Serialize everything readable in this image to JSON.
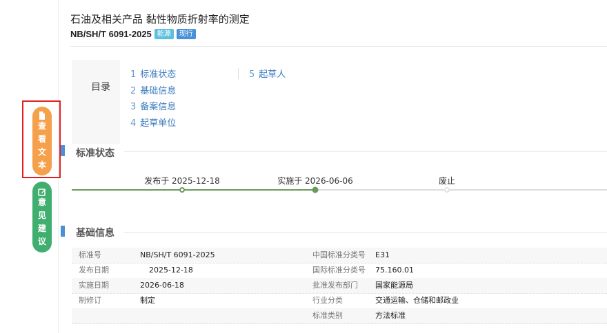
{
  "header": {
    "title": "石油及相关产品 黏性物质折射率的测定",
    "code": "NB/SH/T 6091-2025",
    "badges": [
      "能源",
      "现行"
    ]
  },
  "toc": {
    "label": "目录",
    "items": [
      {
        "num": "1",
        "label": "标准状态"
      },
      {
        "num": "2",
        "label": "基础信息"
      },
      {
        "num": "3",
        "label": "备案信息"
      },
      {
        "num": "4",
        "label": "起草单位"
      },
      {
        "num": "5",
        "label": "起草人"
      }
    ]
  },
  "status_section": {
    "title": "标准状态",
    "milestones": [
      "发布于 2025-12-18",
      "实施于 2026-06-06",
      "废止"
    ]
  },
  "basic_section": {
    "title": "基础信息",
    "left": [
      {
        "k": "标准号",
        "v": "NB/SH/T 6091-2025"
      },
      {
        "k": "发布日期",
        "v": "2025-12-18"
      },
      {
        "k": "实施日期",
        "v": "2026-06-18"
      },
      {
        "k": "制修订",
        "v": "制定"
      }
    ],
    "right": [
      {
        "k": "中国标准分类号",
        "v": "E31"
      },
      {
        "k": "国际标准分类号",
        "v": "75.160.01"
      },
      {
        "k": "批准发布部门",
        "v": "国家能源局"
      },
      {
        "k": "行业分类",
        "v": "交通运输、仓储和邮政业"
      },
      {
        "k": "标准类别",
        "v": "方法标准"
      }
    ]
  },
  "float_buttons": {
    "view_text": [
      "查",
      "看",
      "文",
      "本"
    ],
    "feedback": [
      "意",
      "见",
      "建",
      "议"
    ]
  },
  "colors": {
    "accent_blue": "#4a90d9",
    "link_blue": "#3a7bbf",
    "timeline_green": "#6a9a5a",
    "orange": "#f5a04a",
    "green": "#3fae6e",
    "highlight_red": "#e02020"
  },
  "icons": {
    "view_text": "document-icon",
    "feedback": "edit-icon"
  }
}
